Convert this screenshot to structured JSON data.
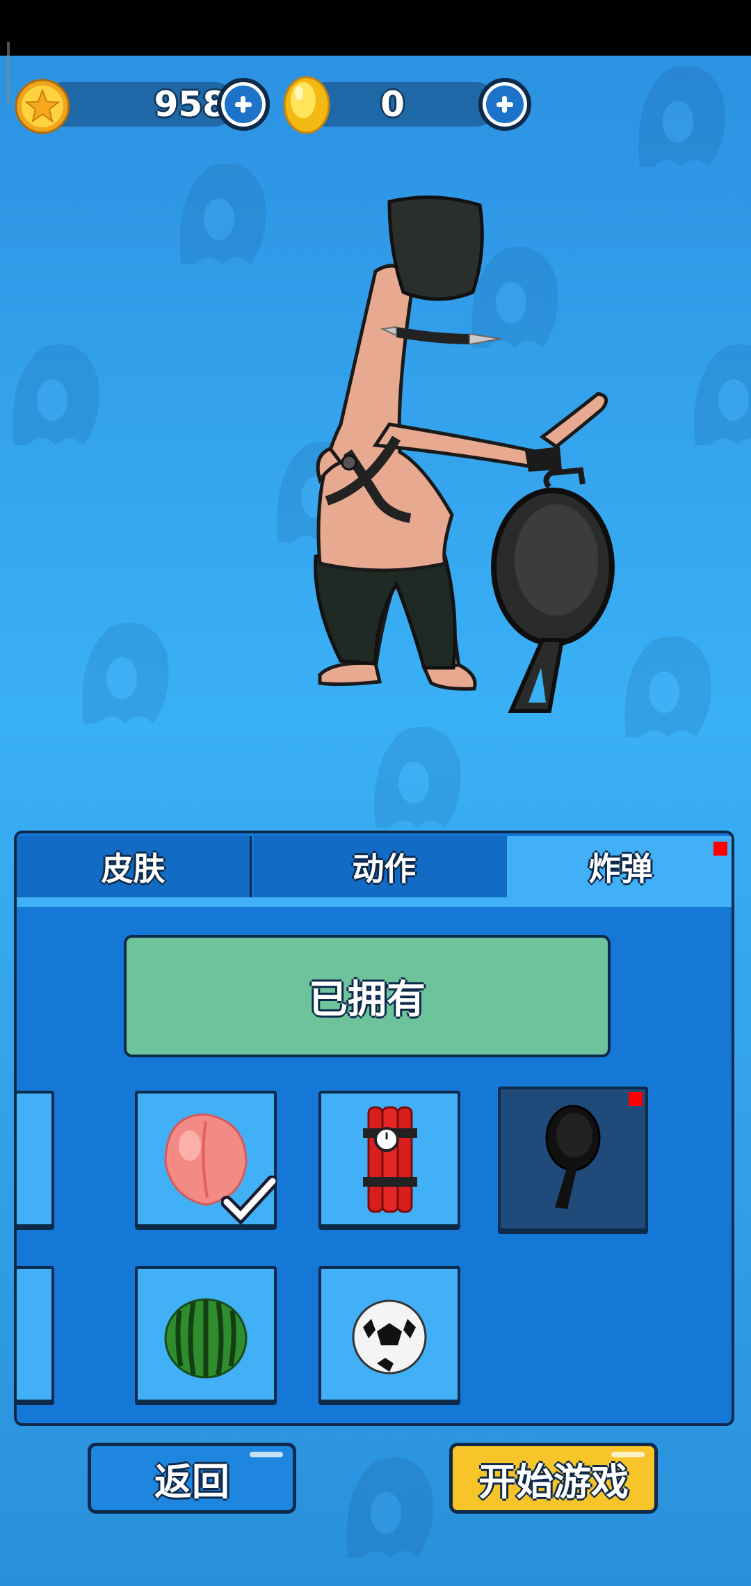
{
  "currency": {
    "stars": "958",
    "gold": "0"
  },
  "tabs": [
    {
      "label": "皮肤",
      "active": false
    },
    {
      "label": "动作",
      "active": false
    },
    {
      "label": "炸弹",
      "active": true
    }
  ],
  "status_banner": "已拥有",
  "items": [
    {
      "name": "peach",
      "selected": false,
      "equipped": true
    },
    {
      "name": "dynamite",
      "selected": false,
      "equipped": false
    },
    {
      "name": "frying-pan",
      "selected": true,
      "equipped": false
    },
    {
      "name": "watermelon",
      "selected": false,
      "equipped": false
    },
    {
      "name": "soccer-ball",
      "selected": false,
      "equipped": false
    }
  ],
  "buttons": {
    "back": "返回",
    "start": "开始游戏"
  },
  "colors": {
    "panel": "#1578d6",
    "tab_active": "#41b0f7",
    "owned_banner": "#6dc49c",
    "back_button": "#1f86e0",
    "start_button": "#f7c52a",
    "new_badge": "#ff0000"
  }
}
